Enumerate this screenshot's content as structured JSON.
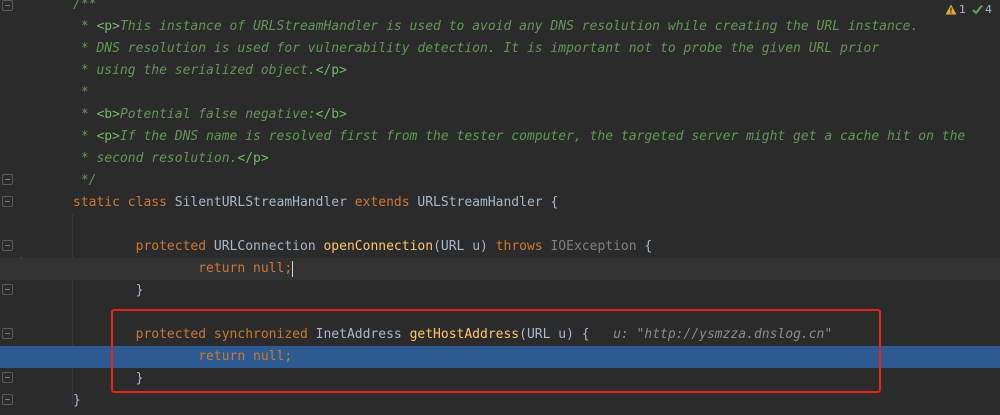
{
  "status": {
    "warnings": "1",
    "checks": "4",
    "warning_icon": "warning-triangle-icon",
    "check_icon": "check-icon"
  },
  "code": {
    "lines": [
      {
        "id": "l1",
        "parts": [
          {
            "c": "doc",
            "t": "/**"
          }
        ]
      },
      {
        "id": "l2",
        "parts": [
          {
            "c": "doc",
            "t": " * "
          },
          {
            "c": "doctag",
            "t": "<p>"
          },
          {
            "c": "doc",
            "t": "This instance of URLStreamHandler is used to avoid any DNS resolution while creating the URL instance."
          }
        ]
      },
      {
        "id": "l3",
        "parts": [
          {
            "c": "doc",
            "t": " * DNS resolution is used for vulnerability detection. It is important not to probe the given URL prior"
          }
        ]
      },
      {
        "id": "l4",
        "parts": [
          {
            "c": "doc",
            "t": " * using the serialized object."
          },
          {
            "c": "doctag",
            "t": "</p>"
          }
        ]
      },
      {
        "id": "l5",
        "parts": [
          {
            "c": "doc",
            "t": " *"
          }
        ]
      },
      {
        "id": "l6",
        "parts": [
          {
            "c": "doc",
            "t": " * "
          },
          {
            "c": "doctag",
            "t": "<b>"
          },
          {
            "c": "doc",
            "t": "Potential false negative:"
          },
          {
            "c": "doctag",
            "t": "</b>"
          }
        ]
      },
      {
        "id": "l7",
        "parts": [
          {
            "c": "doc",
            "t": " * "
          },
          {
            "c": "doctag",
            "t": "<p>"
          },
          {
            "c": "doc",
            "t": "If the DNS name is resolved first from the tester computer, the targeted server might get a cache hit on the"
          }
        ]
      },
      {
        "id": "l8",
        "parts": [
          {
            "c": "doc",
            "t": " * second resolution."
          },
          {
            "c": "doctag",
            "t": "</p>"
          }
        ]
      },
      {
        "id": "l9",
        "parts": [
          {
            "c": "doc",
            "t": " */"
          }
        ]
      },
      {
        "id": "l10",
        "parts": [
          {
            "c": "kw",
            "t": "static class "
          },
          {
            "c": "plain",
            "t": "SilentURLStreamHandler "
          },
          {
            "c": "kw",
            "t": "extends "
          },
          {
            "c": "plain",
            "t": "URLStreamHandler {"
          }
        ]
      },
      {
        "id": "l11",
        "parts": []
      },
      {
        "id": "l12",
        "parts": [
          {
            "c": "plain",
            "t": "        "
          },
          {
            "c": "kw",
            "t": "protected "
          },
          {
            "c": "plain",
            "t": "URLConnection "
          },
          {
            "c": "fn",
            "t": "openConnection"
          },
          {
            "c": "plain",
            "t": "(URL u) "
          },
          {
            "c": "kw",
            "t": "throws "
          },
          {
            "c": "gray",
            "t": "IOException"
          },
          {
            "c": "plain",
            "t": " {"
          }
        ]
      },
      {
        "id": "l13",
        "parts": [
          {
            "c": "plain",
            "t": "                "
          },
          {
            "c": "kw",
            "t": "return null;"
          }
        ]
      },
      {
        "id": "l14",
        "parts": [
          {
            "c": "plain",
            "t": "        }"
          }
        ]
      },
      {
        "id": "l15",
        "parts": []
      },
      {
        "id": "l16",
        "parts": [
          {
            "c": "plain",
            "t": "        "
          },
          {
            "c": "kw",
            "t": "protected synchronized "
          },
          {
            "c": "plain",
            "t": "InetAddress "
          },
          {
            "c": "fn",
            "t": "getHostAddress"
          },
          {
            "c": "plain",
            "t": "(URL u) {   "
          },
          {
            "c": "hint",
            "t": "u: \"http://ysmzza.dnslog.cn\""
          }
        ]
      },
      {
        "id": "l17",
        "parts": [
          {
            "c": "plain",
            "t": "                "
          },
          {
            "c": "kw",
            "t": "return null;"
          }
        ]
      },
      {
        "id": "l18",
        "parts": [
          {
            "c": "plain",
            "t": "        }"
          }
        ]
      },
      {
        "id": "l19",
        "parts": [
          {
            "c": "plain",
            "t": "}"
          }
        ]
      }
    ]
  }
}
